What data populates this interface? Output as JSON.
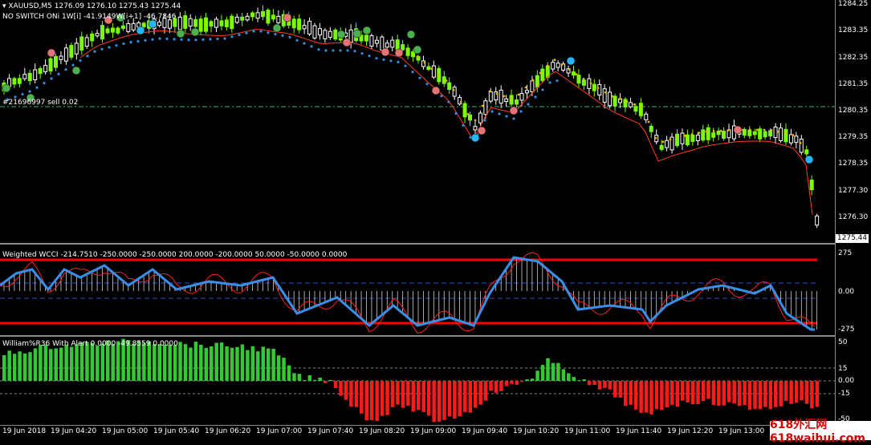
{
  "main_chart": {
    "title_line": "XAUUSD,M5  1276.09 1276.10 1275.43 1275.44",
    "indicator_line": "NO SWITCH ONi 1W[i] -41.9149W[i+1] -46.7846",
    "order_label": "#21696997 sell 0.02",
    "price_labels": [
      "1284.25",
      "1283.35",
      "1282.35",
      "1281.35",
      "1280.35",
      "1279.35",
      "1278.35",
      "1277.30",
      "1276.30"
    ],
    "current_price": "1275.44",
    "colors": {
      "bull": "#7CFC00",
      "bear": "#ffffff",
      "ma": "#ff3b1f",
      "trail": "#2f8fe0",
      "order_line": "#3cb371"
    }
  },
  "cci_panel": {
    "title": "Weighted WCCI -214.7510 -250.0000 -250.0000 200.0000 -200.0000 50.0000 -50.0000 0.0000",
    "levels": [
      "275",
      "0.00",
      "-275"
    ]
  },
  "wpr_panel": {
    "title": "William%R36 With Alert 0.0000 -49.8559 0.0000",
    "levels": [
      "50",
      "15",
      "0.00",
      "-15",
      "-50"
    ]
  },
  "time_labels": [
    "19 Jun 2018",
    "19 Jun 04:20",
    "19 Jun 05:00",
    "19 Jun 05:40",
    "19 Jun 06:20",
    "19 Jun 07:00",
    "19 Jun 07:40",
    "19 Jun 08:20",
    "19 Jun 09:00",
    "19 Jun 09:40",
    "19 Jun 10:20",
    "19 Jun 11:00",
    "19 Jun 11:40",
    "19 Jun 12:20",
    "19 Jun 13:00"
  ],
  "watermark": "618外汇网 618waihui.com"
}
